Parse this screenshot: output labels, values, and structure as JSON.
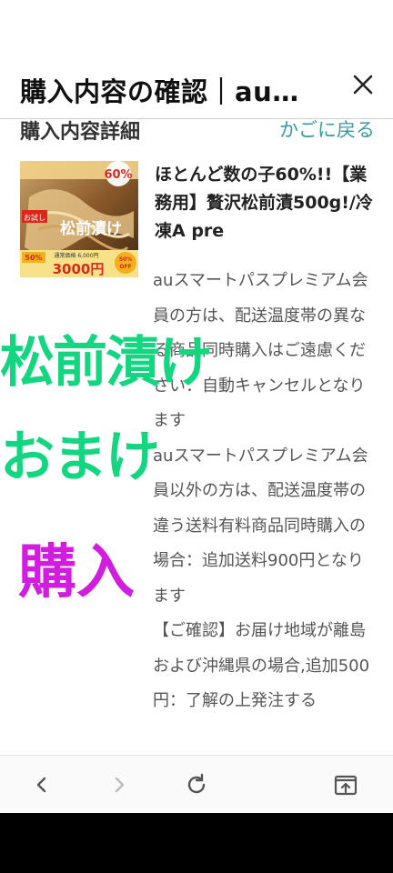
{
  "header": {
    "title": "購入内容の確認｜au…",
    "close_icon": "close-icon"
  },
  "subheader": {
    "title": "購入内容詳細",
    "back_link": "かごに戻る",
    "link_color": "#3a9aa4"
  },
  "product": {
    "name": "ほとんど数の子60%!!【業務用】贅沢松前漬500g!/冷凍A pre",
    "thumbnail": {
      "percent_badge": "60%",
      "label_main": "松前漬け",
      "label_tag": "お試し",
      "price_old": "通常価格 6,000円",
      "price_new": "3000円",
      "off_badge": "50% OFF",
      "small_badge": "50%"
    },
    "notes": [
      "auスマートパスプレミアム会員の方は、配送温度帯の異なる商品同時購入はご遠慮ください：自動キャンセルとなります",
      "auスマートパスプレミアム会員以外の方は、配送温度帯の違う送料有料商品同時購入の場合：追加送料900円となります",
      "【ご確認】お届け地域が離島および沖縄県の場合,追加500円：了解の上発注する"
    ]
  },
  "overlays": [
    {
      "text": "松前漬け",
      "color": "#14d680"
    },
    {
      "text": "おまけ",
      "color": "#14d680"
    },
    {
      "text": "購入",
      "color": "#d21ce0"
    }
  ],
  "bottom_nav": {
    "back_icon": "chevron-left-icon",
    "forward_icon": "chevron-right-icon",
    "reload_icon": "reload-icon",
    "share_icon": "open-in-app-icon"
  }
}
